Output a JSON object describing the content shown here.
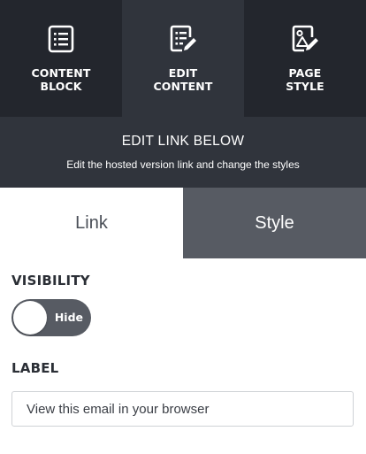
{
  "nav": {
    "items": [
      {
        "label": "CONTENT\nBLOCK",
        "icon": "list-document-icon"
      },
      {
        "label": "EDIT\nCONTENT",
        "icon": "edit-document-icon"
      },
      {
        "label": "PAGE\nSTYLE",
        "icon": "image-edit-icon"
      }
    ],
    "active_index": 1
  },
  "banner": {
    "title": "EDIT LINK BELOW",
    "subtitle": "Edit the hosted version link and change the styles"
  },
  "tabs": {
    "link_label": "Link",
    "style_label": "Style",
    "selected": "Style"
  },
  "visibility": {
    "label": "VISIBILITY",
    "toggle_text": "Hide",
    "on": false
  },
  "label_field": {
    "label": "LABEL",
    "value": "View this email in your browser"
  },
  "colors": {
    "nav_dark": "#23262d",
    "nav_active": "#30343c",
    "style_tab": "#575b63"
  }
}
